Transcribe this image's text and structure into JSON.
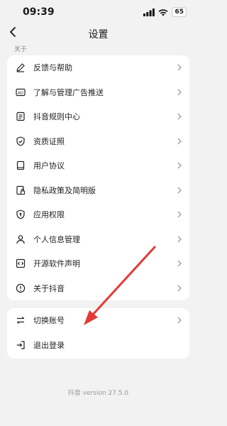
{
  "status": {
    "time": "09:39",
    "battery": "65"
  },
  "nav": {
    "title": "设置"
  },
  "section": {
    "label": "关于"
  },
  "about_items": [
    {
      "label": "反馈与帮助",
      "icon": "edit-icon"
    },
    {
      "label": "了解与管理广告推送",
      "icon": "ad-icon"
    },
    {
      "label": "抖音规则中心",
      "icon": "rules-icon"
    },
    {
      "label": "资质证照",
      "icon": "shield-check-icon"
    },
    {
      "label": "用户协议",
      "icon": "book-icon"
    },
    {
      "label": "隐私政策及简明版",
      "icon": "privacy-lock-icon"
    },
    {
      "label": "应用权限",
      "icon": "permission-shield-icon"
    },
    {
      "label": "个人信息管理",
      "icon": "person-icon"
    },
    {
      "label": "开源软件声明",
      "icon": "code-icon"
    },
    {
      "label": "关于抖音",
      "icon": "info-icon"
    }
  ],
  "account_items": [
    {
      "label": "切换账号",
      "icon": "switch-icon"
    },
    {
      "label": "退出登录",
      "icon": "logout-icon"
    }
  ],
  "footer": {
    "version": "抖音 version 27.5.0"
  },
  "colors": {
    "annotation_arrow": "#e53935",
    "background": "#f2f2f2"
  }
}
